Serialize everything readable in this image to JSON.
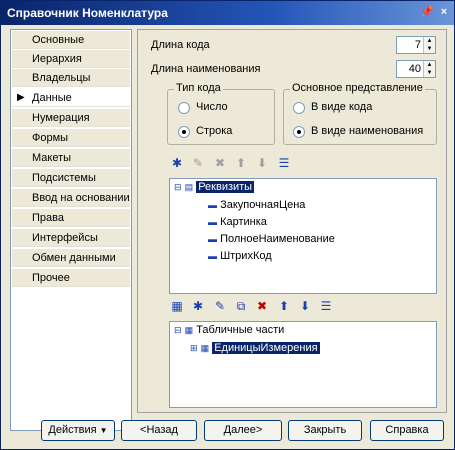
{
  "window": {
    "title": "Справочник Номенклатура",
    "pin_icon": "pin-icon",
    "close_icon": "close-icon"
  },
  "sidebar": {
    "items": [
      {
        "label": "Основные",
        "active": false
      },
      {
        "label": "Иерархия",
        "active": false
      },
      {
        "label": "Владельцы",
        "active": false
      },
      {
        "label": "Данные",
        "active": true
      },
      {
        "label": "Нумерация",
        "active": false
      },
      {
        "label": "Формы",
        "active": false
      },
      {
        "label": "Макеты",
        "active": false
      },
      {
        "label": "Подсистемы",
        "active": false
      },
      {
        "label": "Ввод на основании",
        "active": false
      },
      {
        "label": "Права",
        "active": false
      },
      {
        "label": "Интерфейсы",
        "active": false
      },
      {
        "label": "Обмен данными",
        "active": false
      },
      {
        "label": "Прочее",
        "active": false
      }
    ]
  },
  "data_panel": {
    "code_length_label": "Длина кода",
    "code_length_value": "7",
    "name_length_label": "Длина наименования",
    "name_length_value": "40",
    "code_type": {
      "legend": "Тип кода",
      "options": [
        "Число",
        "Строка"
      ],
      "selected": "Строка"
    },
    "main_presentation": {
      "legend": "Основное представление",
      "options": [
        "В виде кода",
        "В виде наименования"
      ],
      "selected": "В виде наименования"
    },
    "attributes_tree": {
      "root": "Реквизиты",
      "children": [
        "ЗакупочнаяЦена",
        "Картинка",
        "ПолноеНаименование",
        "ШтрихКод"
      ]
    },
    "tabular_tree": {
      "root": "Табличные части",
      "children": [
        "ЕдиницыИзмерения"
      ]
    }
  },
  "footer": {
    "actions": "Действия",
    "back": "<Назад",
    "next": "Далее>",
    "close": "Закрыть",
    "help": "Справка"
  }
}
